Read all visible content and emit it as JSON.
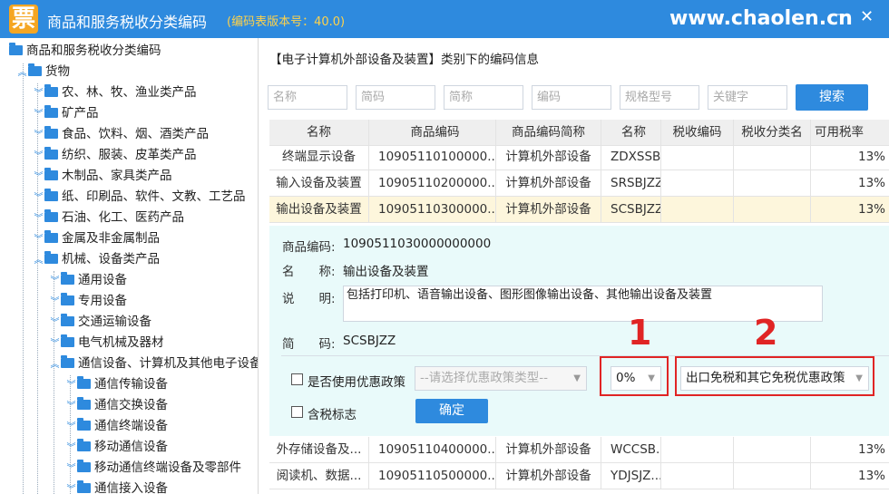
{
  "window": {
    "title": "商品和服务税收分类编码",
    "version": "(编码表版本号：40.0)",
    "logo_char": "票",
    "watermark": "www.chaolen.cn",
    "minimize": "—",
    "close": "✕"
  },
  "tree": {
    "root": "商品和服务税收分类编码",
    "goods": "货物",
    "items": [
      "农、林、牧、渔业类产品",
      "矿产品",
      "食品、饮料、烟、酒类产品",
      "纺织、服装、皮革类产品",
      "木制品、家具类产品",
      "纸、印刷品、软件、文教、工艺品",
      "石油、化工、医药产品",
      "金属及非金属制品",
      "机械、设备类产品"
    ],
    "machinery_children": [
      "通用设备",
      "专用设备",
      "交通运输设备",
      "电气机械及器材",
      "通信设备、计算机及其他电子设备"
    ],
    "comm_children": [
      "通信传输设备",
      "通信交换设备",
      "通信终端设备",
      "移动通信设备",
      "移动通信终端设备及零部件",
      "通信接入设备"
    ]
  },
  "main": {
    "title": "【电子计算机外部设备及装置】类别下的编码信息",
    "filters": {
      "name": "名称",
      "code": "简码",
      "short": "简称",
      "number": "编码",
      "model": "规格型号",
      "keyword": "关键字"
    },
    "search_label": "搜索",
    "columns": [
      "名称",
      "商品编码",
      "商品编码简称",
      "名称",
      "税收编码",
      "税收分类名",
      "可用税率"
    ],
    "rows": [
      {
        "name": "终端显示设备",
        "code": "10905110100000...",
        "short": "计算机外部设备",
        "alias": "ZDXSSB",
        "rate": "13%"
      },
      {
        "name": "输入设备及装置",
        "code": "10905110200000...",
        "short": "计算机外部设备",
        "alias": "SRSBJZZ",
        "rate": "13%"
      },
      {
        "name": "输出设备及装置",
        "code": "10905110300000...",
        "short": "计算机外部设备",
        "alias": "SCSBJZZ",
        "rate": "13%"
      }
    ],
    "rows_after": [
      {
        "name": "外存储设备及...",
        "code": "10905110400000...",
        "short": "计算机外部设备",
        "alias": "WCCSB...",
        "rate": "13%"
      },
      {
        "name": "阅读机、数据...",
        "code": "10905110500000...",
        "short": "计算机外部设备",
        "alias": "YDJSJZ...",
        "rate": "13%"
      }
    ],
    "detail": {
      "code_label": "商品编码:",
      "code_value": "1090511030000000000",
      "name_label": "名　　称:",
      "name_value": "输出设备及装置",
      "desc_label": "说　　明:",
      "desc_value": "包括打印机、语音输出设备、图形图像输出设备、其他输出设备及装置",
      "short_label": "简　　码:",
      "short_value": "SCSBJZZ",
      "preferential_label": "是否使用优惠政策",
      "preferential_placeholder": "--请选择优惠政策类型--",
      "rate_value": "0%",
      "exempt_value": "出口免税和其它免税优惠政策",
      "tax_included_label": "含税标志",
      "confirm_label": "确定"
    },
    "annotations": [
      "1",
      "2"
    ]
  }
}
